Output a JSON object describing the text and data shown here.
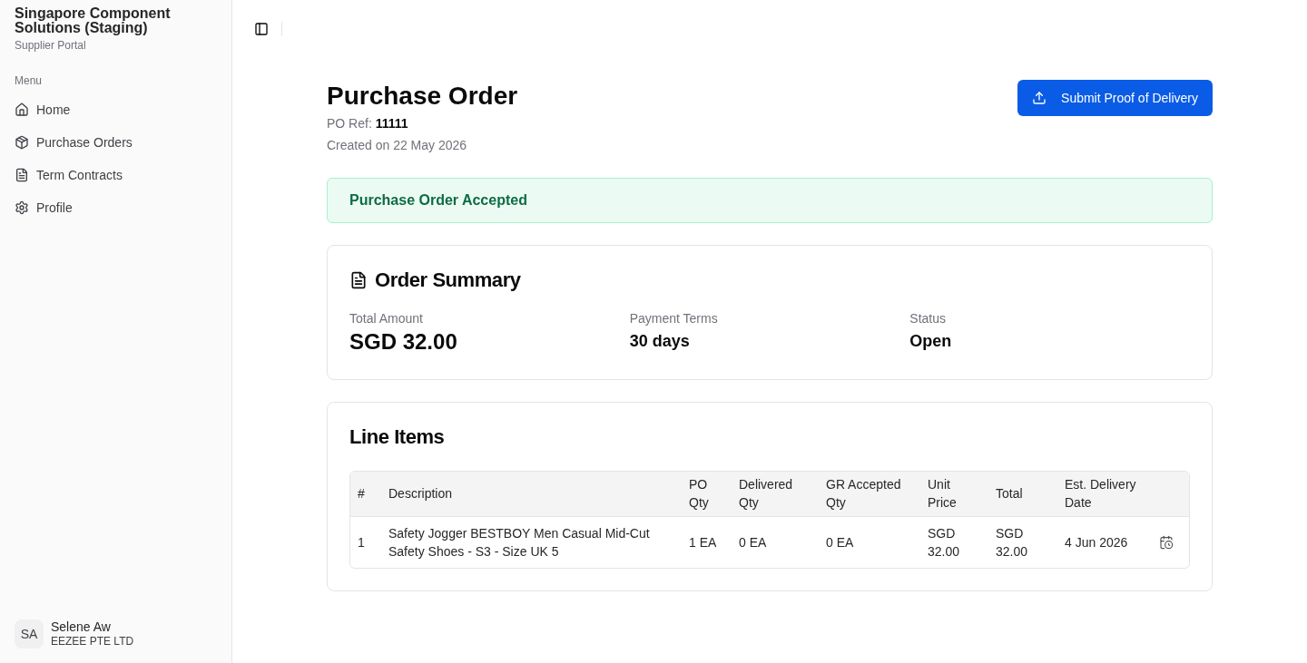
{
  "sidebar": {
    "org_name": "Singapore Component Solutions (Staging)",
    "portal": "Supplier Portal",
    "menu_label": "Menu",
    "items": [
      {
        "label": "Home"
      },
      {
        "label": "Purchase Orders"
      },
      {
        "label": "Term Contracts"
      },
      {
        "label": "Profile"
      }
    ]
  },
  "user": {
    "initials": "SA",
    "name": "Selene Aw",
    "company": "EEZEE PTE LTD"
  },
  "page": {
    "title": "Purchase Order",
    "po_ref": "PO Ref: **11111**",
    "created": "Created on 22 May 2026",
    "action_button": "Submit Proof of Delivery"
  },
  "alert": {
    "text": "Purchase Order Accepted"
  },
  "order_summary": {
    "title": "Order Summary",
    "fields": [
      {
        "label": "Total Amount",
        "value": "SGD 32.00",
        "kind": "amount"
      },
      {
        "label": "Payment Terms",
        "value": "30 days",
        "kind": "text"
      },
      {
        "label": "Status",
        "value": "Open",
        "kind": "text"
      }
    ]
  },
  "line_items": {
    "title": "Line Items",
    "columns": [
      "#",
      "Description",
      "PO Qty",
      "Delivered Qty",
      "GR Accepted Qty",
      "Unit Price",
      "Total",
      "Est. Delivery Date"
    ],
    "rows": [
      {
        "cells": [
          "1",
          "Safety Jogger BESTBOY Men Casual Mid-Cut Safety Shoes - S3 - Size UK 5",
          "1 EA",
          "0 EA",
          "0 EA",
          "SGD 32.00",
          "SGD 32.00",
          "4 Jun 2026"
        ]
      }
    ]
  }
}
